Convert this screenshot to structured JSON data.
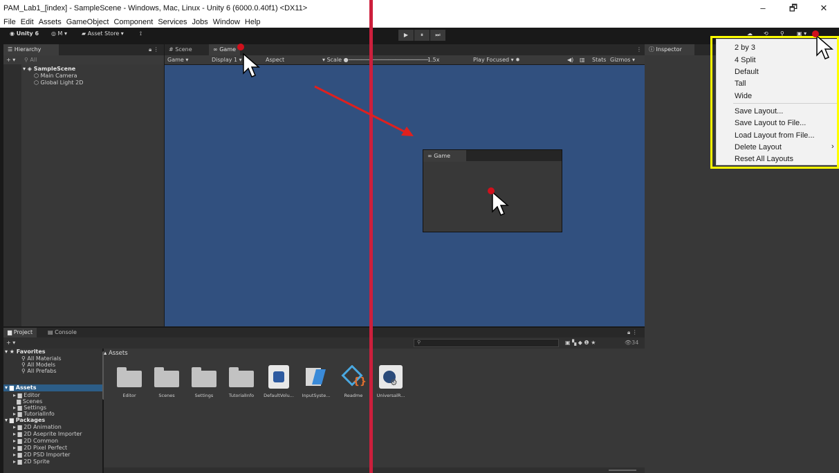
{
  "window": {
    "title": "PAM_Lab1_[index] - SampleScene - Windows, Mac, Linux - Unity 6 (6000.0.40f1) <DX11>",
    "minimize": "–",
    "maximize": "🗗",
    "close": "✕"
  },
  "menubar": [
    "File",
    "Edit",
    "Assets",
    "GameObject",
    "Component",
    "Services",
    "Jobs",
    "Window",
    "Help"
  ],
  "toolbar": {
    "unity_label": "Unity 6",
    "account_label": "M ▾",
    "asset_store_label": "Asset Store ▾",
    "play": "▶",
    "pause": "⏸",
    "step": "⏭"
  },
  "hierarchy": {
    "tab": "Hierarchy",
    "search_placeholder": "All",
    "scene": "SampleScene",
    "items": [
      "Main Camera",
      "Global Light 2D"
    ]
  },
  "scene_tabs": {
    "scene": "Scene",
    "game": "Game"
  },
  "game_toolbar": {
    "mode": "Game",
    "display": "Display 1",
    "aspect": "Aspect",
    "scale_label": "Scale",
    "scale_value": "1.5x",
    "play_focused": "Play Focused",
    "stats": "Stats",
    "gizmos": "Gizmos"
  },
  "inspector": {
    "tab": "Inspector"
  },
  "floating_game": {
    "tab": "Game"
  },
  "layout_menu": {
    "items": [
      "2 by 3",
      "4 Split",
      "Default",
      "Tall",
      "Wide"
    ],
    "actions": [
      "Save Layout...",
      "Save Layout to File...",
      "Load Layout from File...",
      "Delete Layout",
      "Reset All Layouts"
    ],
    "submenu_arrow": "›"
  },
  "project": {
    "tab_project": "Project",
    "tab_console": "Console",
    "favorites_label": "Favorites",
    "favorites": [
      "All Materials",
      "All Models",
      "All Prefabs"
    ],
    "assets_label": "Assets",
    "assets_tree": [
      "Editor",
      "Scenes",
      "Settings",
      "TutorialInfo"
    ],
    "packages_label": "Packages",
    "packages": [
      "2D Animation",
      "2D Aseprite Importer",
      "2D Common",
      "2D Pixel Perfect",
      "2D PSD Importer",
      "2D Sprite"
    ],
    "breadcrumb": "Assets",
    "asset_count": "34",
    "grid": [
      "Editor",
      "Scenes",
      "Settings",
      "TutorialInfo",
      "DefaultVolu...",
      "InputSyste...",
      "Readme",
      "UniversalR..."
    ]
  },
  "colors": {
    "game_view": "#31507f",
    "highlight": "#ffff00",
    "red_line": "#cc1f3c",
    "arrow": "#e0201e"
  }
}
